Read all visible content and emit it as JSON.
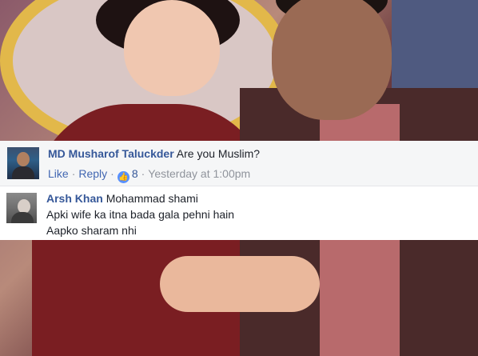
{
  "comments": [
    {
      "author": "MD Musharof Taluckder",
      "text": "Are you Muslim?",
      "actions": {
        "like_label": "Like",
        "reply_label": "Reply",
        "reaction_count": "8",
        "timestamp": "Yesterday at 1:00pm"
      }
    },
    {
      "author": "Arsh Khan",
      "lines": [
        "Mohammad shami",
        "Apki wife ka itna bada gala pehni hain",
        "Aapko sharam nhi"
      ]
    }
  ],
  "colors": {
    "author_link": "#365899",
    "action_link": "#4267b2",
    "meta_text": "#90949c",
    "reaction_badge": "#5890ff"
  },
  "icons": {
    "reaction": "like-thumb-icon"
  }
}
